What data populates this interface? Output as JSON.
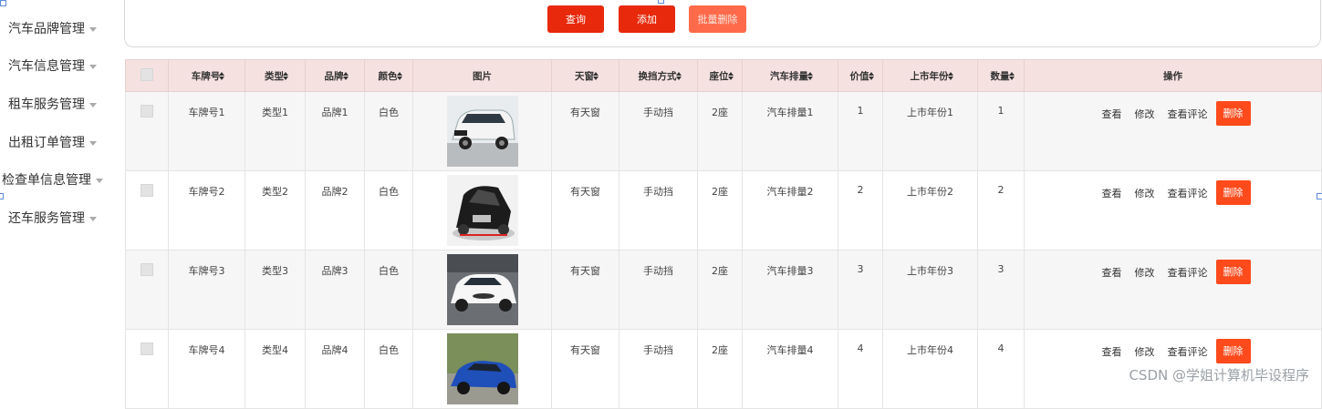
{
  "sidebar": {
    "items": [
      {
        "label": "汽车品牌管理"
      },
      {
        "label": "汽车信息管理"
      },
      {
        "label": "租车服务管理"
      },
      {
        "label": "出租订单管理"
      },
      {
        "label": "检查单信息管理"
      },
      {
        "label": "还车服务管理"
      }
    ]
  },
  "toolbar": {
    "query_label": "查询",
    "add_label": "添加",
    "batch_delete_label": "批量删除"
  },
  "table": {
    "headers": [
      "车牌号",
      "类型",
      "品牌",
      "颜色",
      "图片",
      "天窗",
      "换挡方式",
      "座位",
      "汽车排量",
      "价值",
      "上市年份",
      "数量",
      "操作"
    ],
    "rows": [
      {
        "plate": "车牌号1",
        "type": "类型1",
        "brand": "品牌1",
        "color": "白色",
        "image": "white-minivan-photo",
        "sunroof": "有天窗",
        "gear": "手动挡",
        "seats": "2座",
        "displacement": "汽车排量1",
        "value": "1",
        "year": "上市年份1",
        "qty": "1"
      },
      {
        "plate": "车牌号2",
        "type": "类型2",
        "brand": "品牌2",
        "color": "白色",
        "image": "black-supercar-photo",
        "sunroof": "有天窗",
        "gear": "手动挡",
        "seats": "2座",
        "displacement": "汽车排量2",
        "value": "2",
        "year": "上市年份2",
        "qty": "2"
      },
      {
        "plate": "车牌号3",
        "type": "类型3",
        "brand": "品牌3",
        "color": "白色",
        "image": "white-hatchback-photo",
        "sunroof": "有天窗",
        "gear": "手动挡",
        "seats": "2座",
        "displacement": "汽车排量3",
        "value": "3",
        "year": "上市年份3",
        "qty": "3"
      },
      {
        "plate": "车牌号4",
        "type": "类型4",
        "brand": "品牌4",
        "color": "白色",
        "image": "blue-coupe-photo",
        "sunroof": "有天窗",
        "gear": "手动挡",
        "seats": "2座",
        "displacement": "汽车排量4",
        "value": "4",
        "year": "上市年份4",
        "qty": "4"
      }
    ],
    "actions": {
      "view": "查看",
      "edit": "修改",
      "view_comments": "查看评论",
      "delete": "删除"
    }
  },
  "watermark": "CSDN @学姐计算机毕设程序",
  "colors": {
    "primary": "#e8290b",
    "batch": "#ff6b4a",
    "delete": "#ff4a1c",
    "header_bg": "#f6e1e1"
  }
}
